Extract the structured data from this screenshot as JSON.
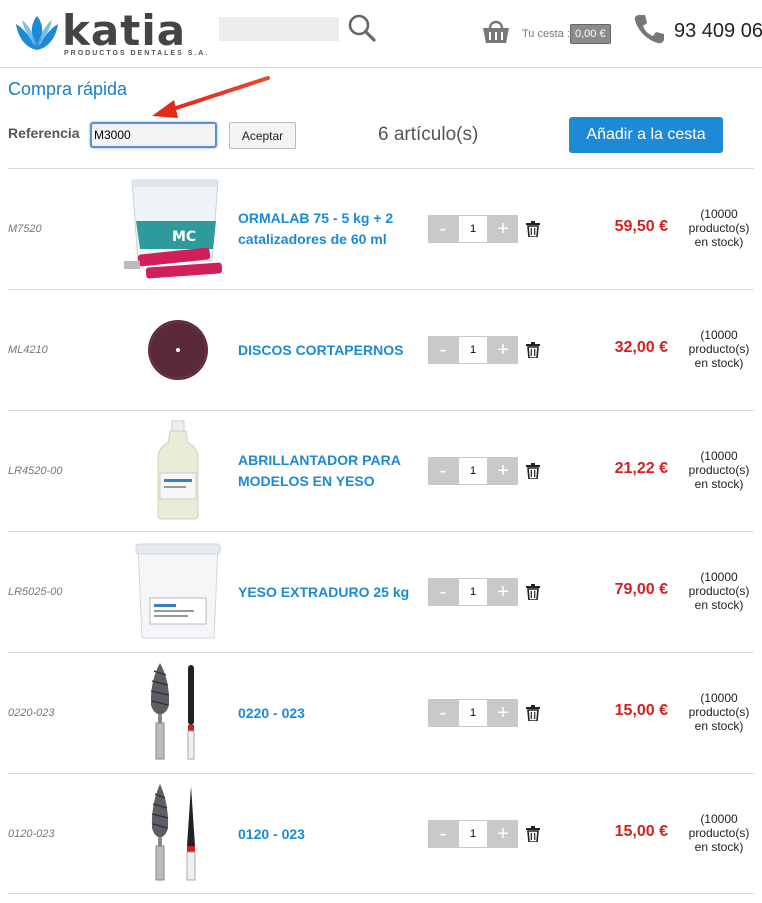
{
  "header": {
    "logo_text": "katia",
    "logo_subtitle": "PRODUCTOS DENTALES S.A.",
    "search_placeholder": "",
    "cart_label": "Tu cesta :",
    "cart_total": "0,00 €",
    "phone": "93 409 06",
    "brand_color": "#1a8ad4"
  },
  "quick_buy": {
    "title": "Compra rápida",
    "reference_label": "Referencia",
    "reference_value": "M3000",
    "accept_label": "Aceptar",
    "item_count": "6 artículo(s)",
    "add_to_cart_label": "Añadir a la cesta"
  },
  "products": [
    {
      "ref": "M7520",
      "name": "ORMALAB 75 - 5 kg + 2 catalizadores de 60 ml",
      "qty": "1",
      "price": "59,50 €",
      "stock": "(10000 producto(s) en stock)",
      "image": "bucket-with-tubes"
    },
    {
      "ref": "ML4210",
      "name": "DISCOS CORTAPERNOS",
      "qty": "1",
      "price": "32,00 €",
      "stock": "(10000 producto(s) en stock)",
      "image": "disc"
    },
    {
      "ref": "LR4520-00",
      "name": "ABRILLANTADOR PARA MODELOS EN YESO",
      "qty": "1",
      "price": "21,22 €",
      "stock": "(10000 producto(s) en stock)",
      "image": "bottle"
    },
    {
      "ref": "LR5025-00",
      "name": "YESO EXTRADURO 25 kg",
      "qty": "1",
      "price": "79,00 €",
      "stock": "(10000 producto(s) en stock)",
      "image": "bucket"
    },
    {
      "ref": "0220-023",
      "name": "0220 - 023",
      "qty": "1",
      "price": "15,00 €",
      "stock": "(10000 producto(s) en stock)",
      "image": "bur"
    },
    {
      "ref": "0120-023",
      "name": "0120 - 023",
      "qty": "1",
      "price": "15,00 €",
      "stock": "(10000 producto(s) en stock)",
      "image": "bur-cone"
    }
  ],
  "controls": {
    "minus": "-",
    "plus": "+"
  }
}
